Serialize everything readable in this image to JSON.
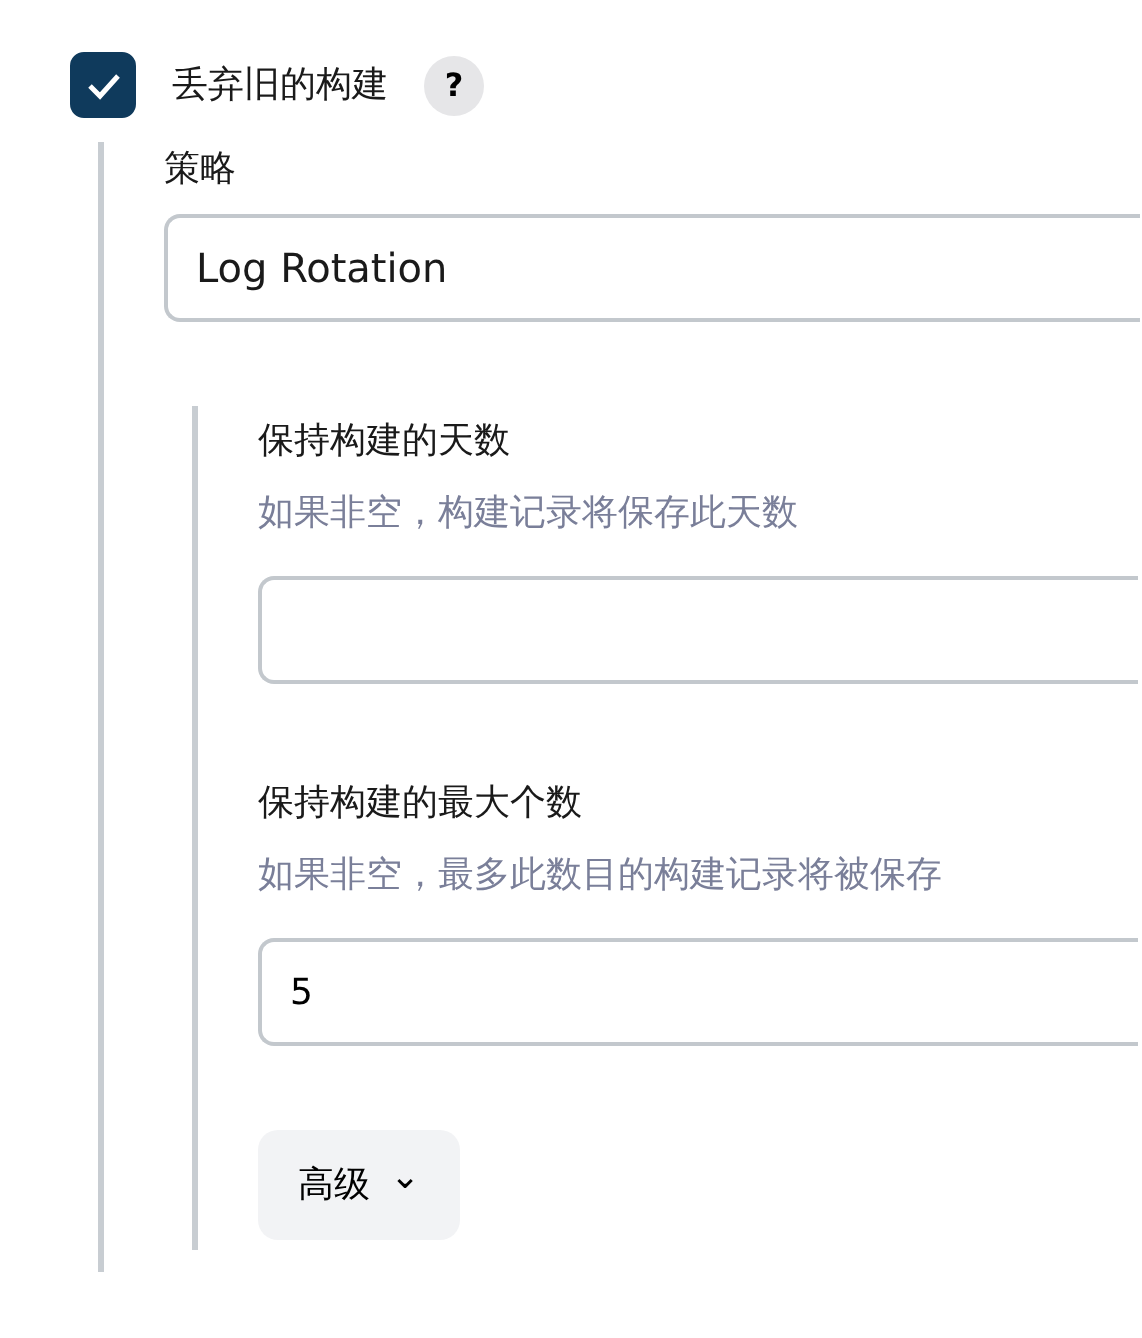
{
  "discard_old_builds": {
    "label": "丢弃旧的构建",
    "checked": true,
    "help": "?"
  },
  "strategy": {
    "label": "策略",
    "value": "Log Rotation"
  },
  "fields": [
    {
      "label": "保持构建的天数",
      "hint": "如果非空，构建记录将保存此天数"
    },
    {
      "label": "保持构建的最大个数",
      "hint": "如果非空，最多此数目的构建记录将被保存",
      "value": "5"
    }
  ],
  "advanced_button": {
    "label": "高级",
    "caret": "⌄"
  }
}
